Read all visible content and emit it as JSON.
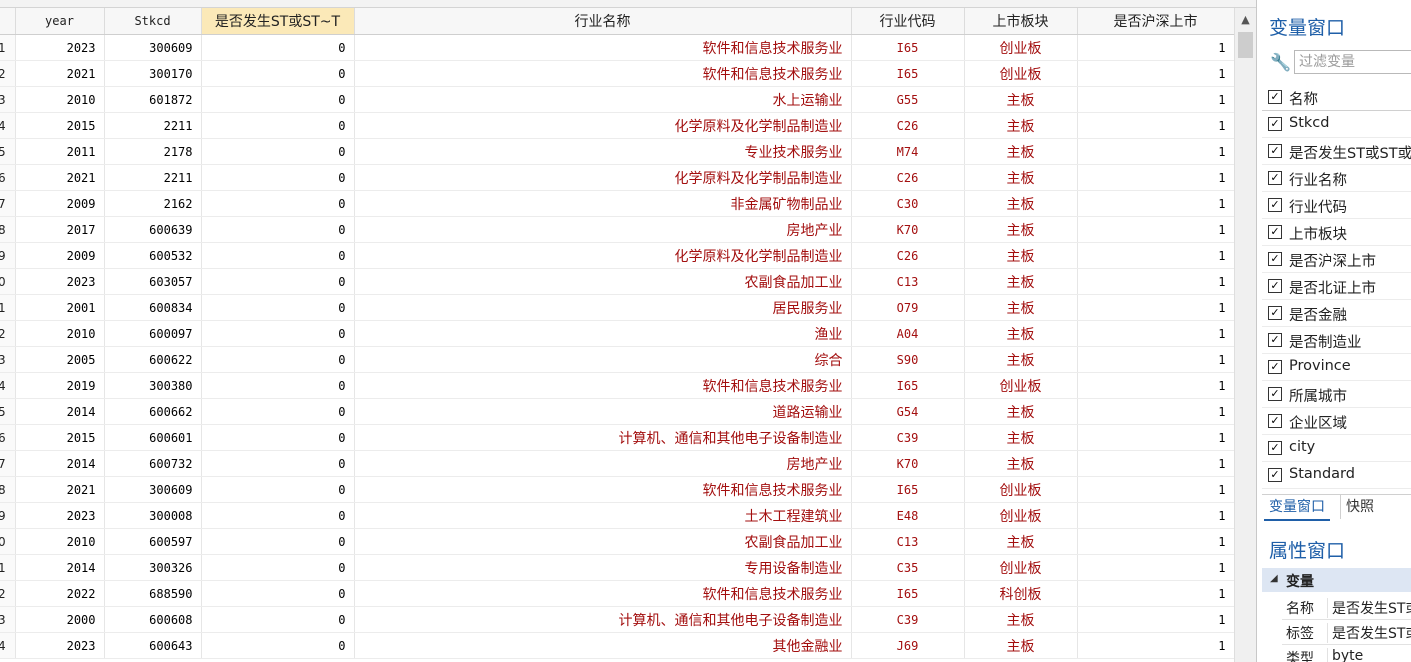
{
  "grid": {
    "columns": [
      "year",
      "Stkcd",
      "是否发生ST或ST~T",
      "行业名称",
      "行业代码",
      "上市板块",
      "是否沪深上市"
    ],
    "rows": [
      {
        "n": "1",
        "year": "2023",
        "stkcd": "300609",
        "st": "0",
        "ind": "软件和信息技术服务业",
        "code": "I65",
        "board": "创业板",
        "hs": "1"
      },
      {
        "n": "2",
        "year": "2021",
        "stkcd": "300170",
        "st": "0",
        "ind": "软件和信息技术服务业",
        "code": "I65",
        "board": "创业板",
        "hs": "1"
      },
      {
        "n": "3",
        "year": "2010",
        "stkcd": "601872",
        "st": "0",
        "ind": "水上运输业",
        "code": "G55",
        "board": "主板",
        "hs": "1"
      },
      {
        "n": "4",
        "year": "2015",
        "stkcd": "2211",
        "st": "0",
        "ind": "化学原料及化学制品制造业",
        "code": "C26",
        "board": "主板",
        "hs": "1"
      },
      {
        "n": "5",
        "year": "2011",
        "stkcd": "2178",
        "st": "0",
        "ind": "专业技术服务业",
        "code": "M74",
        "board": "主板",
        "hs": "1"
      },
      {
        "n": "6",
        "year": "2021",
        "stkcd": "2211",
        "st": "0",
        "ind": "化学原料及化学制品制造业",
        "code": "C26",
        "board": "主板",
        "hs": "1"
      },
      {
        "n": "7",
        "year": "2009",
        "stkcd": "2162",
        "st": "0",
        "ind": "非金属矿物制品业",
        "code": "C30",
        "board": "主板",
        "hs": "1"
      },
      {
        "n": "8",
        "year": "2017",
        "stkcd": "600639",
        "st": "0",
        "ind": "房地产业",
        "code": "K70",
        "board": "主板",
        "hs": "1"
      },
      {
        "n": "9",
        "year": "2009",
        "stkcd": "600532",
        "st": "0",
        "ind": "化学原料及化学制品制造业",
        "code": "C26",
        "board": "主板",
        "hs": "1"
      },
      {
        "n": "0",
        "year": "2023",
        "stkcd": "603057",
        "st": "0",
        "ind": "农副食品加工业",
        "code": "C13",
        "board": "主板",
        "hs": "1"
      },
      {
        "n": "1",
        "year": "2001",
        "stkcd": "600834",
        "st": "0",
        "ind": "居民服务业",
        "code": "O79",
        "board": "主板",
        "hs": "1"
      },
      {
        "n": "2",
        "year": "2010",
        "stkcd": "600097",
        "st": "0",
        "ind": "渔业",
        "code": "A04",
        "board": "主板",
        "hs": "1"
      },
      {
        "n": "3",
        "year": "2005",
        "stkcd": "600622",
        "st": "0",
        "ind": "综合",
        "code": "S90",
        "board": "主板",
        "hs": "1"
      },
      {
        "n": "4",
        "year": "2019",
        "stkcd": "300380",
        "st": "0",
        "ind": "软件和信息技术服务业",
        "code": "I65",
        "board": "创业板",
        "hs": "1"
      },
      {
        "n": "5",
        "year": "2014",
        "stkcd": "600662",
        "st": "0",
        "ind": "道路运输业",
        "code": "G54",
        "board": "主板",
        "hs": "1"
      },
      {
        "n": "6",
        "year": "2015",
        "stkcd": "600601",
        "st": "0",
        "ind": "计算机、通信和其他电子设备制造业",
        "code": "C39",
        "board": "主板",
        "hs": "1"
      },
      {
        "n": "7",
        "year": "2014",
        "stkcd": "600732",
        "st": "0",
        "ind": "房地产业",
        "code": "K70",
        "board": "主板",
        "hs": "1"
      },
      {
        "n": "8",
        "year": "2021",
        "stkcd": "300609",
        "st": "0",
        "ind": "软件和信息技术服务业",
        "code": "I65",
        "board": "创业板",
        "hs": "1"
      },
      {
        "n": "9",
        "year": "2023",
        "stkcd": "300008",
        "st": "0",
        "ind": "土木工程建筑业",
        "code": "E48",
        "board": "创业板",
        "hs": "1"
      },
      {
        "n": "0",
        "year": "2010",
        "stkcd": "600597",
        "st": "0",
        "ind": "农副食品加工业",
        "code": "C13",
        "board": "主板",
        "hs": "1"
      },
      {
        "n": "1",
        "year": "2014",
        "stkcd": "300326",
        "st": "0",
        "ind": "专用设备制造业",
        "code": "C35",
        "board": "创业板",
        "hs": "1"
      },
      {
        "n": "2",
        "year": "2022",
        "stkcd": "688590",
        "st": "0",
        "ind": "软件和信息技术服务业",
        "code": "I65",
        "board": "科创板",
        "hs": "1"
      },
      {
        "n": "3",
        "year": "2000",
        "stkcd": "600608",
        "st": "0",
        "ind": "计算机、通信和其他电子设备制造业",
        "code": "C39",
        "board": "主板",
        "hs": "1"
      },
      {
        "n": "4",
        "year": "2023",
        "stkcd": "600643",
        "st": "0",
        "ind": "其他金融业",
        "code": "J69",
        "board": "主板",
        "hs": "1"
      }
    ],
    "scroll_up_glyph": "▲"
  },
  "variables_window": {
    "title": "变量窗口",
    "filter_placeholder": "过滤变量",
    "header_label": "名称",
    "check_glyph": "✓",
    "items": [
      "Stkcd",
      "是否发生ST或ST或",
      "行业名称",
      "行业代码",
      "上市板块",
      "是否沪深上市",
      "是否北证上市",
      "是否金融",
      "是否制造业",
      "Province",
      "所属城市",
      "企业区域",
      "city",
      "Standard"
    ]
  },
  "tabs": {
    "variables": "变量窗口",
    "snapshot": "快照"
  },
  "properties_window": {
    "title": "属性窗口",
    "group_label": "变量",
    "group_glyph": "◢",
    "rows": [
      {
        "key": "名称",
        "value": "是否发生ST或"
      },
      {
        "key": "标签",
        "value": "是否发生ST或"
      },
      {
        "key": "类型",
        "value": "byte"
      }
    ]
  },
  "colors": {
    "string_text": "#a30f0f",
    "accent": "#1f5fa8",
    "highlight_header": "#fbe9b8"
  }
}
